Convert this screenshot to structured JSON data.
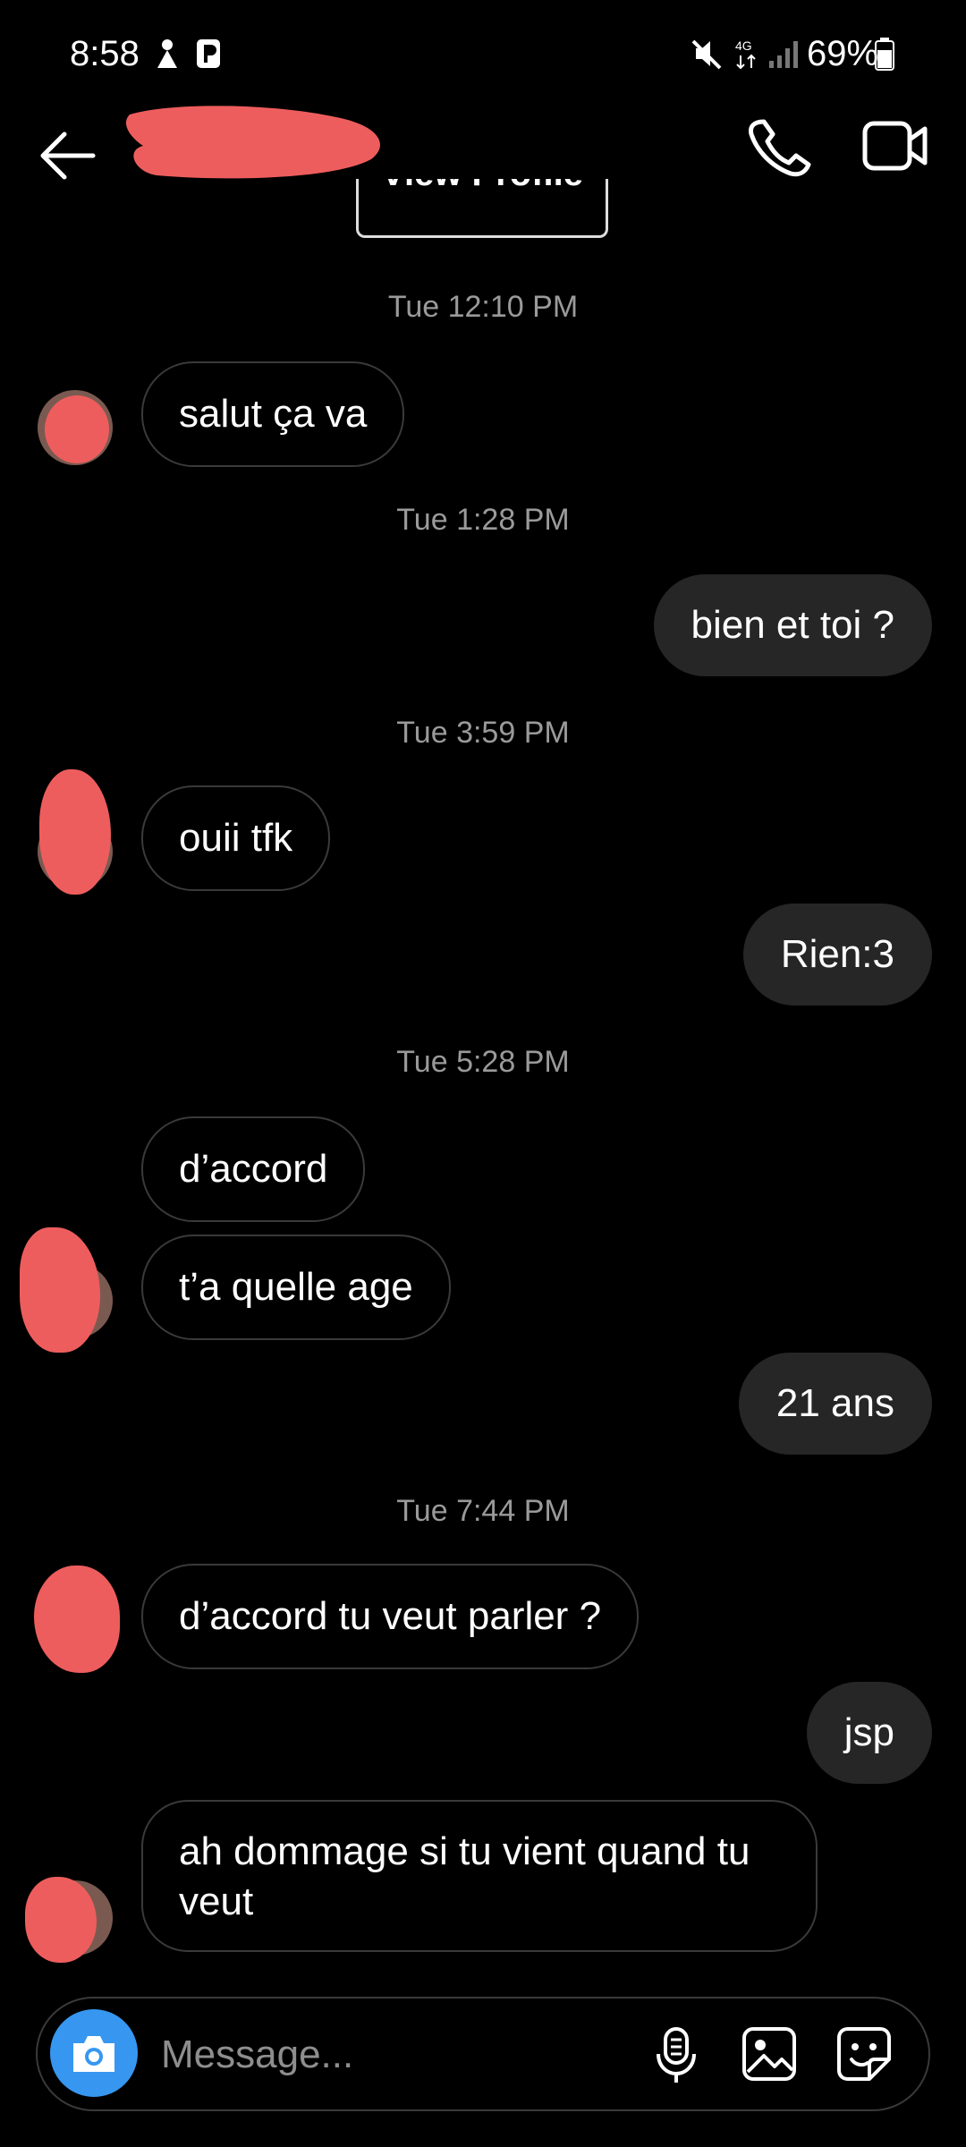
{
  "status_bar": {
    "time": "8:58",
    "network": "4G",
    "battery": "69%"
  },
  "header": {
    "back_icon": "arrow-left-icon",
    "call_icon": "phone-icon",
    "video_icon": "video-camera-icon"
  },
  "profile_button": "View Profile",
  "messages": [
    {
      "type": "timestamp",
      "text": "Tue 12:10 PM"
    },
    {
      "type": "in",
      "text": "salut ça va"
    },
    {
      "type": "timestamp",
      "text": "Tue 1:28 PM"
    },
    {
      "type": "out",
      "text": "bien et toi ?"
    },
    {
      "type": "timestamp",
      "text": "Tue 3:59 PM"
    },
    {
      "type": "in",
      "text": "ouii tfk"
    },
    {
      "type": "out",
      "text": "Rien:3"
    },
    {
      "type": "timestamp",
      "text": "Tue 5:28 PM"
    },
    {
      "type": "in",
      "text": "d’accord"
    },
    {
      "type": "in",
      "text": "t’a quelle age"
    },
    {
      "type": "out",
      "text": "21 ans"
    },
    {
      "type": "timestamp",
      "text": "Tue 7:44 PM"
    },
    {
      "type": "in",
      "text": "d’accord tu veut parler ?"
    },
    {
      "type": "out",
      "text": "jsp"
    },
    {
      "type": "in",
      "text": "ah dommage si tu vient quand tu veut"
    }
  ],
  "composer": {
    "placeholder": "Message...",
    "camera_icon": "camera-icon",
    "mic_icon": "microphone-icon",
    "gallery_icon": "image-icon",
    "sticker_icon": "sticker-icon"
  },
  "colors": {
    "background": "#000000",
    "outgoing_bubble": "#262626",
    "incoming_border": "#3a3a3a",
    "timestamp": "#9a9a9a",
    "camera_button": "#3797f0",
    "redaction": "#ee5d5d"
  }
}
